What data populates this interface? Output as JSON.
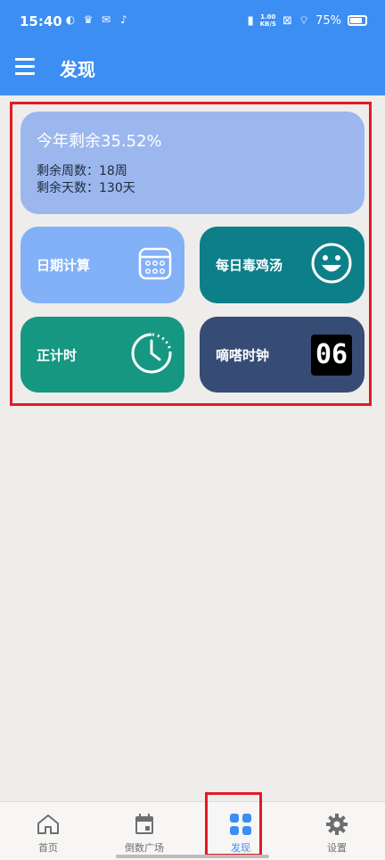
{
  "status_bar": {
    "time": "15:40",
    "net_speed": "1.00",
    "net_unit": "KB/S",
    "battery": "75%"
  },
  "app_bar": {
    "title": "发现"
  },
  "year_card": {
    "headline": "今年剩余35.52%",
    "weeks_left": "剩余周数：18周",
    "days_left": "剩余天数：130天"
  },
  "tiles": [
    {
      "label": "日期计算",
      "icon": "calendar-icon",
      "color": "#82b1f7"
    },
    {
      "label": "每日毒鸡汤",
      "icon": "smiley-icon",
      "color": "#0d7f89"
    },
    {
      "label": "正计时",
      "icon": "stopwatch-icon",
      "color": "#169781"
    },
    {
      "label": "嘀嗒时钟",
      "icon": "flip-clock-icon",
      "digits": "06",
      "color": "#374c74"
    }
  ],
  "bottom_nav": {
    "items": [
      {
        "label": "首页",
        "icon": "home-icon"
      },
      {
        "label": "倒数广场",
        "icon": "calendar-icon"
      },
      {
        "label": "发现",
        "icon": "grid-icon",
        "active": true
      },
      {
        "label": "设置",
        "icon": "gear-icon"
      }
    ]
  },
  "colors": {
    "primary": "#3c8ef3",
    "highlight": "#e01b24",
    "background": "#efedeb"
  }
}
